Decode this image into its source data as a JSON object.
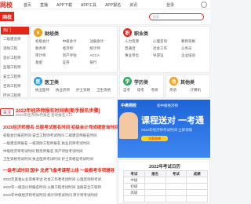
{
  "topbar": {
    "logo": "网校",
    "nav": [
      "首页",
      "直播",
      "APP下载",
      "APP工具",
      "APP报名",
      "资讯"
    ],
    "right_link": "登录"
  },
  "header": {
    "logo": "网校",
    "search_placeholder": "搜索"
  },
  "left_column": {
    "head": "热门",
    "items": [
      "二级建造师",
      "消防工程",
      "造价工程师",
      "监理工程师",
      "安全工程师",
      "咨询工程师",
      "环评工程师",
      "房地产估价师",
      "公路工程师"
    ]
  },
  "panels": [
    {
      "title": "财经类",
      "icon": "￥",
      "color": "#f0a020",
      "items": [
        "初级会计",
        "中级会计",
        "注册会计",
        "税务师",
        "经济师",
        "统计师",
        "审计师",
        "资产评估",
        "ACCA",
        "基金",
        "证券",
        "银行"
      ]
    },
    {
      "title": "职业类",
      "icon": "职",
      "color": "#e42618",
      "items": [
        "人力资源",
        "心理咨询",
        "教师资格",
        "普通话",
        "社会工作",
        "公务员",
        "事业单位",
        "导游证",
        "企业培训"
      ]
    },
    {
      "title": "医卫类",
      "icon": "医",
      "color": "#2a9de8",
      "items": [
        "执业医师",
        "执业药师",
        "护士资格",
        "卫生资格"
      ]
    },
    {
      "title": "学历类",
      "icon": "学",
      "color": "#2aa85e",
      "items": [
        "自考",
        "成考",
        "考研"
      ]
    },
    {
      "title": "其他类",
      "icon": "他",
      "color": "#f0a020",
      "items": [
        "英语",
        "计算机"
      ]
    }
  ],
  "news": {
    "tag": "关注",
    "headline": "2022年经济师报名时间表[新手报名步骤]",
    "subline": "2022年经济师8月报名 各地报名入口",
    "rows": [
      {
        "text": "2022经济师报名  出版考试报名时间  初级会计师成绩查询时间",
        "style": "red"
      },
      {
        "text": "初级会计报名时间  安全工程师考试时间  二级建造师报名时间",
        "style": "gray"
      },
      {
        "text": "一级建造师报名  一级消防工程师报名  执业药师考试时间",
        "style": "gray"
      },
      {
        "text": "中级经济师考试时间  税务师报名  资产评估考试时间",
        "style": "gray"
      },
      {
        "text": "卫生资格考试时间  执业医师考试时间  护士资格证考试时间",
        "style": "gray"
      },
      {
        "text": "一级考试时间  国中  龙虎飞备考课程上线  一级报考专项辅导",
        "style": "red"
      },
      {
        "text": "2022年基金从业资格考试  社会工作者考试时间  心理咨询师考试",
        "style": "gray"
      },
      {
        "text": "2022年一级造价师报名时间  公路工程考试时间  注册安全工程师",
        "style": "gray"
      },
      {
        "text": "2022年中级经济师考试时间  统计师考试时间  审计师考试时间",
        "style": "gray"
      }
    ]
  },
  "banner": {
    "brand": "中奥网校",
    "tagline": "初中级经济师",
    "headline": "课程送对 一考通",
    "sub": "2022年经济师考试时间 立即领取",
    "button": "立即咨询"
  },
  "schedule": {
    "title": "2022年考试日历",
    "headers": [
      "考试",
      "报名",
      "考试",
      "成绩"
    ],
    "rows": [
      [
        "中级",
        "",
        "",
        ""
      ],
      [
        "初级",
        "",
        "",
        ""
      ],
      [
        "高级",
        "",
        "",
        ""
      ],
      [
        "",
        "",
        "",
        ""
      ]
    ]
  }
}
